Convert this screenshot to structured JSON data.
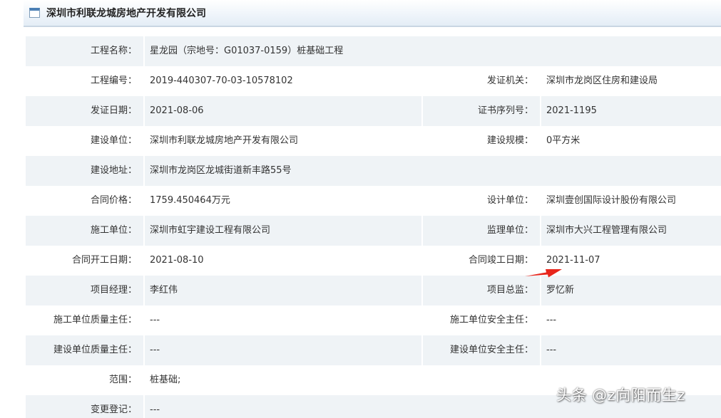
{
  "header": {
    "title": "深圳市利联龙城房地产开发有限公司",
    "icon": "window-icon"
  },
  "rows": [
    {
      "shade": true,
      "left_label": "工程名称：",
      "left_value": "星龙园（宗地号：G01037-0159）桩基础工程",
      "right_label": "",
      "right_value": ""
    },
    {
      "shade": false,
      "left_label": "工程编号：",
      "left_value": "2019-440307-70-03-10578102",
      "right_label": "发证机关：",
      "right_value": "深圳市龙岗区住房和建设局"
    },
    {
      "shade": true,
      "left_label": "发证日期：",
      "left_value": "2021-08-06",
      "right_label": "证书序列号：",
      "right_value": "2021-1195"
    },
    {
      "shade": false,
      "left_label": "建设单位：",
      "left_value": "深圳市利联龙城房地产开发有限公司",
      "right_label": "建设规模：",
      "right_value": "0平方米"
    },
    {
      "shade": true,
      "left_label": "建设地址：",
      "left_value": "深圳市龙岗区龙城街道新丰路55号",
      "right_label": "",
      "right_value": ""
    },
    {
      "shade": false,
      "left_label": "合同价格：",
      "left_value": "1759.450464万元",
      "right_label": "设计单位：",
      "right_value": "深圳壹创国际设计股份有限公司"
    },
    {
      "shade": true,
      "left_label": "施工单位：",
      "left_value": "深圳市虹宇建设工程有限公司",
      "right_label": "监理单位：",
      "right_value": "深圳市大兴工程管理有限公司"
    },
    {
      "shade": false,
      "left_label": "合同开工日期：",
      "left_value": "2021-08-10",
      "right_label": "合同竣工日期：",
      "right_value": "2021-11-07"
    },
    {
      "shade": true,
      "left_label": "项目经理：",
      "left_value": "李红伟",
      "right_label": "项目总监：",
      "right_value": "罗忆新"
    },
    {
      "shade": false,
      "left_label": "施工单位质量主任：",
      "left_value": "---",
      "right_label": "施工单位安全主任：",
      "right_value": "---"
    },
    {
      "shade": true,
      "left_label": "建设单位质量主任：",
      "left_value": "---",
      "right_label": "建设单位安全主任：",
      "right_value": "---"
    },
    {
      "shade": false,
      "left_label": "范围：",
      "left_value": "桩基础;",
      "right_label": "",
      "right_value": ""
    },
    {
      "shade": true,
      "left_label": "变更登记：",
      "left_value": "---",
      "right_label": "",
      "right_value": ""
    }
  ],
  "annotation": {
    "icon": "red-arrow-icon",
    "color": "#e8261c"
  },
  "watermark": {
    "text": "头条 @z向阳而生z"
  },
  "colors": {
    "row_shade": "#eff3f6",
    "header_bg": "#e9f0f7"
  }
}
